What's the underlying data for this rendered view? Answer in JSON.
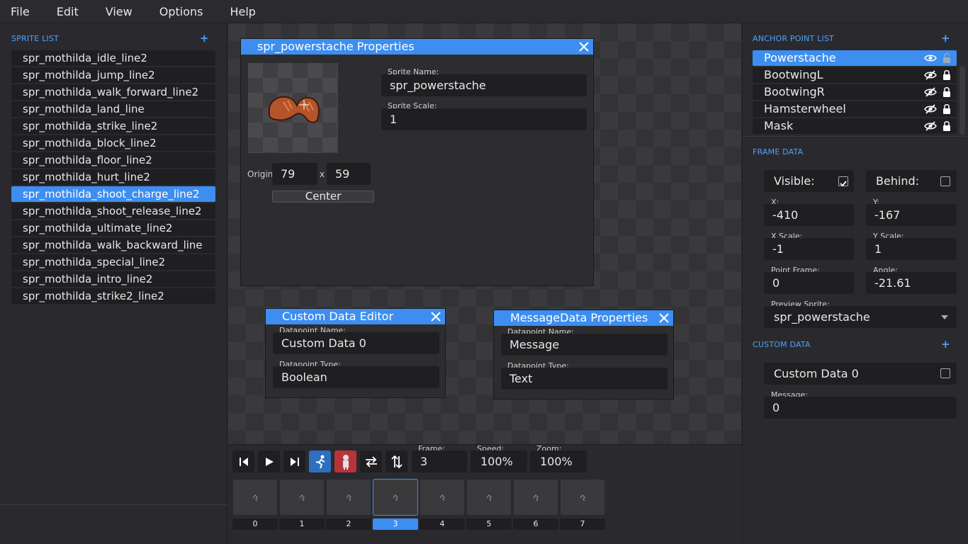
{
  "menu": [
    "File",
    "Edit",
    "View",
    "Options",
    "Help"
  ],
  "sprite_list": {
    "title": "SPRITE LIST",
    "add_label": "+",
    "items": [
      "spr_mothilda_idle_line2",
      "spr_mothilda_jump_line2",
      "spr_mothilda_walk_forward_line2",
      "spr_mothilda_land_line",
      "spr_mothilda_strike_line2",
      "spr_mothilda_block_line2",
      "spr_mothilda_floor_line2",
      "spr_mothilda_hurt_line2",
      "spr_mothilda_shoot_charge_line2",
      "spr_mothilda_shoot_release_line2",
      "spr_mothilda_ultimate_line2",
      "spr_mothilda_walk_backward_line",
      "spr_mothilda_special_line2",
      "spr_mothilda_intro_line2",
      "spr_mothilda_strike2_line2"
    ],
    "selected_index": 8
  },
  "sprite_props": {
    "title": "spr_powerstache Properties",
    "name_label": "Sprite Name:",
    "name_value": "spr_powerstache",
    "scale_label": "Sprite Scale:",
    "scale_value": "1",
    "origin_label": "Origin",
    "origin_x": "79",
    "origin_sep": "x",
    "origin_y": "59",
    "center_button": "Center"
  },
  "custom_data_editor": {
    "title": "Custom Data Editor",
    "name_label": "Datapoint Name:",
    "name_value": "Custom Data 0",
    "type_label": "Datapoint Type:",
    "type_value": "Boolean"
  },
  "message_props": {
    "title": "MessageData Properties",
    "name_label": "Datapoint Name:",
    "name_value": "Message",
    "type_label": "Datapoint Type:",
    "type_value": "Text"
  },
  "toolbar": {
    "frame_label": "Frame:",
    "frame_value": "3",
    "speed_label": "Speed:",
    "speed_value": "100%",
    "zoom_label": "Zoom:",
    "zoom_value": "100%"
  },
  "frames": [
    "0",
    "1",
    "2",
    "3",
    "4",
    "5",
    "6",
    "7"
  ],
  "selected_frame": 3,
  "anchor_list": {
    "title": "ANCHOR POINT LIST",
    "add_label": "+",
    "items": [
      "Powerstache",
      "BootwingL",
      "BootwingR",
      "Hamsterwheel",
      "Mask"
    ],
    "selected_index": 0
  },
  "frame_data": {
    "title": "FRAME DATA",
    "visible_label": "Visible:",
    "visible_checked": true,
    "behind_label": "Behind:",
    "behind_checked": false,
    "x_label": "X:",
    "x_value": "-410",
    "y_label": "Y:",
    "y_value": "-167",
    "xscale_label": "X Scale:",
    "xscale_value": "-1",
    "yscale_label": "Y Scale:",
    "yscale_value": "1",
    "pointframe_label": "Point Frame:",
    "pointframe_value": "0",
    "angle_label": "Angle:",
    "angle_value": "-21.61",
    "preview_label": "Preview Sprite:",
    "preview_value": "spr_powerstache"
  },
  "custom_data": {
    "title": "CUSTOM DATA",
    "add_label": "+",
    "item_label": "Custom Data 0",
    "item_checked": false,
    "message_label": "Message:",
    "message_value": "0"
  },
  "colors": {
    "accent": "#3d8ef0",
    "background": "#2a2a2e",
    "field": "#1f1f22"
  }
}
